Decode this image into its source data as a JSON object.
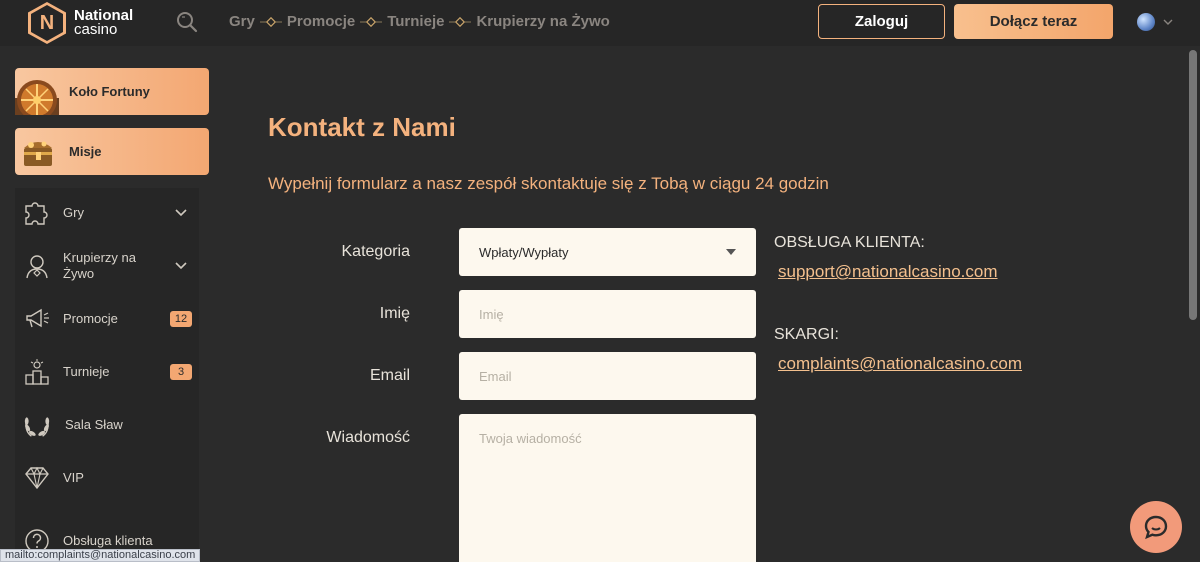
{
  "brand": {
    "name_line1": "National",
    "name_line2": "casino",
    "logo_letter": "N"
  },
  "header": {
    "nav": [
      "Gry",
      "Promocje",
      "Turnieje",
      "Krupierzy na Żywo"
    ],
    "login_label": "Zaloguj",
    "join_label": "Dołącz teraz"
  },
  "sidebar": {
    "promos": [
      {
        "label": "Koło Fortuny",
        "icon": "fortune-wheel-icon"
      },
      {
        "label": "Misje",
        "icon": "treasure-chest-icon"
      }
    ],
    "menu": [
      {
        "label": "Gry",
        "icon": "puzzle-icon",
        "has_chevron": true
      },
      {
        "label": "Krupierzy na Żywo",
        "icon": "dealer-icon",
        "has_chevron": true
      },
      {
        "label": "Promocje",
        "icon": "megaphone-icon",
        "badge": "12"
      },
      {
        "label": "Turnieje",
        "icon": "podium-icon",
        "badge": "3"
      },
      {
        "label": "Sala Sław",
        "icon": "laurel-icon"
      },
      {
        "label": "VIP",
        "icon": "diamond-icon"
      },
      {
        "label": "Obsługa klienta",
        "icon": "help-icon"
      }
    ]
  },
  "main": {
    "title": "Kontakt z Nami",
    "subtitle": "Wypełnij formularz a nasz zespół skontaktuje się z Tobą w ciągu 24 godzin",
    "form": {
      "category_label": "Kategoria",
      "category_value": "Wpłaty/Wypłaty",
      "name_label": "Imię",
      "name_placeholder": "Imię",
      "email_label": "Email",
      "email_placeholder": "Email",
      "message_label": "Wiadomość",
      "message_placeholder": "Twoja wiadomość"
    },
    "contacts": {
      "support_heading": "OBSŁUGA KLIENTA:",
      "support_email": "support@nationalcasino.com",
      "complaints_heading": "SKARGI:",
      "complaints_email": "complaints@nationalcasino.com"
    }
  },
  "status_bar": {
    "url": "mailto:complaints@nationalcasino.com"
  },
  "colors": {
    "accent": "#f4b27e",
    "background": "#2b2b2b",
    "field": "#fdf8ee",
    "chat": "#f29a7a"
  }
}
